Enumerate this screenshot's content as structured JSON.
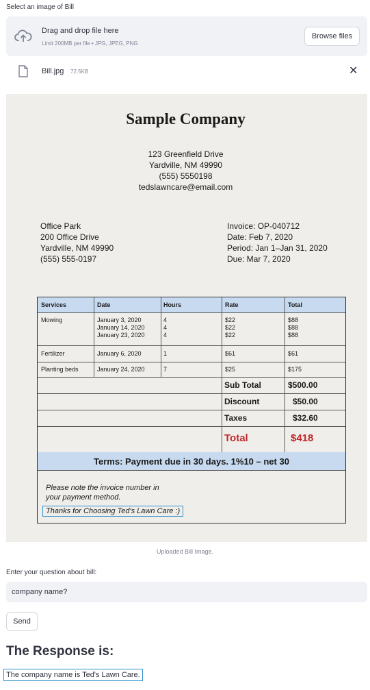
{
  "uploader": {
    "label": "Select an image of Bill",
    "drop_title": "Drag and drop file here",
    "drop_sub": "Limit 200MB per file • JPG, JPEG, PNG",
    "browse_label": "Browse files",
    "file_name": "Bill.jpg",
    "file_size": "72.5KB",
    "close_glyph": "✕"
  },
  "bill": {
    "company": "Sample Company",
    "address": [
      "123 Greenfield Drive",
      "Yardville, NM 49990",
      "(555) 5550198",
      "tedslawncare@email.com"
    ],
    "bill_to": [
      "Office Park",
      "200 Office Drive",
      "Yardville, NM 49990",
      "(555) 555-0197"
    ],
    "invoice_info": [
      "Invoice: OP-040712",
      "Date: Feb 7, 2020",
      "Period: Jan 1–Jan 31, 2020",
      "Due: Mar 7, 2020"
    ],
    "headers": [
      "Services",
      "Date",
      "Hours",
      "Rate",
      "Total"
    ],
    "rows": [
      {
        "service": "Mowing",
        "dates": "January 3, 2020\nJanuary 14, 2020\nJanuary 23, 2020",
        "hours": "4\n4\n4",
        "rate": "$22\n$22\n$22",
        "total": "$88\n$88\n$88"
      },
      {
        "service": "Fertilizer",
        "dates": "January 6, 2020",
        "hours": "1",
        "rate": "$61",
        "total": "$61"
      },
      {
        "service": "Planting beds",
        "dates": "January 24, 2020",
        "hours": "7",
        "rate": "$25",
        "total": "$175"
      }
    ],
    "subtotal_label": "Sub Total",
    "subtotal_value": "$500.00",
    "discount_label": "Discount",
    "discount_value": "$50.00",
    "taxes_label": "Taxes",
    "taxes_value": "$32.60",
    "total_label": "Total",
    "total_value": "$418",
    "terms": "Terms: Payment due in 30 days. 1%10 – net 30",
    "note_line1": "Please note the invoice number in",
    "note_line2": "your payment method.",
    "thanks": "Thanks for Choosing Ted's Lawn Care :)"
  },
  "caption": "Uploaded Bill Image.",
  "question": {
    "label": "Enter your question about bill:",
    "value": "company name?",
    "send_label": "Send"
  },
  "response": {
    "title": "The Response is:",
    "text": "The company name is Ted's Lawn Care."
  },
  "icons": {
    "upload": "cloud-upload-icon",
    "file": "file-icon",
    "close": "close-icon"
  },
  "colors": {
    "table_header": "#c7daf0",
    "total_red": "#c0282c",
    "highlight_box": "#2e8fce"
  }
}
